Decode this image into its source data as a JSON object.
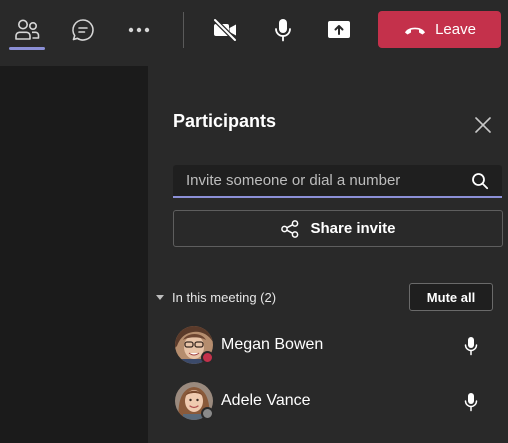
{
  "toolbar": {
    "leave_label": "Leave",
    "icons": [
      "people-icon",
      "chat-icon",
      "more-icon",
      "camera-off-icon",
      "microphone-icon",
      "share-screen-icon",
      "phone-hangup-icon"
    ],
    "colors": {
      "leave": "#c4314b",
      "accent": "#8b8fd6",
      "background": "#292929"
    }
  },
  "panel": {
    "title": "Participants",
    "search_placeholder": "Invite someone or dial a number",
    "share_invite_label": "Share invite",
    "section": {
      "label": "In this meeting (2)",
      "mute_all_label": "Mute all"
    },
    "participants": [
      {
        "name": "Megan Bowen",
        "status": "busy",
        "status_color": "#c4314b"
      },
      {
        "name": "Adele Vance",
        "status": "offline",
        "status_color": "#8a8a8a"
      }
    ]
  }
}
